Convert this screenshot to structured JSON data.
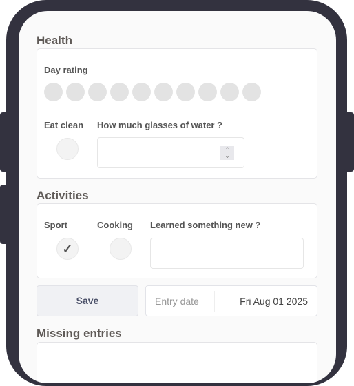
{
  "health": {
    "title": "Health",
    "day_rating_label": "Day rating",
    "rating_count": 10,
    "rating_value": 0,
    "eat_clean_label": "Eat clean",
    "eat_clean_checked": false,
    "water_label": "How much glasses of water ?",
    "water_value": ""
  },
  "activities": {
    "title": "Activities",
    "sport_label": "Sport",
    "sport_checked": true,
    "cooking_label": "Cooking",
    "cooking_checked": false,
    "learned_label": "Learned something new ?",
    "learned_value": ""
  },
  "actions": {
    "save_label": "Save",
    "entry_date_label": "Entry date",
    "entry_date_value": "Fri Aug 01 2025"
  },
  "missing": {
    "title": "Missing entries"
  }
}
